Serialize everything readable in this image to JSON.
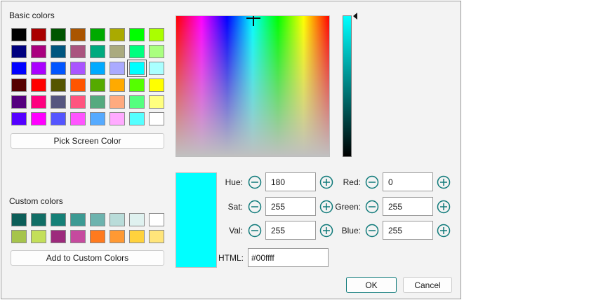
{
  "basic_colors": {
    "label": "Basic colors",
    "swatches": [
      "#000000",
      "#aa0000",
      "#005500",
      "#aa5500",
      "#00aa00",
      "#aaaa00",
      "#00ff00",
      "#aaff00",
      "#00007f",
      "#aa007f",
      "#00557f",
      "#aa557f",
      "#00aa7f",
      "#aaaa7f",
      "#00ff7f",
      "#aaff7f",
      "#0000ff",
      "#aa00ff",
      "#0055ff",
      "#aa55ff",
      "#00aaff",
      "#aaaaff",
      "#00ffff",
      "#aaffff",
      "#550000",
      "#ff0000",
      "#555500",
      "#ff5500",
      "#55aa00",
      "#ffaa00",
      "#55ff00",
      "#ffff00",
      "#55007f",
      "#ff007f",
      "#55557f",
      "#ff557f",
      "#55aa7f",
      "#ffaa7f",
      "#55ff7f",
      "#ffff7f",
      "#5500ff",
      "#ff00ff",
      "#5555ff",
      "#ff55ff",
      "#55aaff",
      "#ffaaff",
      "#55ffff",
      "#ffffff"
    ],
    "selected_index": 22
  },
  "pick_screen_color_label": "Pick Screen Color",
  "custom_colors": {
    "label": "Custom colors",
    "swatches": [
      "#0c5e59",
      "#116e66",
      "#158077",
      "#3c9a93",
      "#6db3ae",
      "#b9dcd9",
      "#dff1ef",
      "#ffffff",
      "#a6c44c",
      "#c3df59",
      "#9d2a7c",
      "#c64a9e",
      "#ff7a1e",
      "#ff9933",
      "#ffd23d",
      "#ffe57a"
    ]
  },
  "add_to_custom_label": "Add to Custom Colors",
  "current_color": "#00ffff",
  "hsv": {
    "hue_label": "Hue:",
    "hue": "180",
    "sat_label": "Sat:",
    "sat": "255",
    "val_label": "Val:",
    "val": "255"
  },
  "rgb": {
    "red_label": "Red:",
    "red": "0",
    "green_label": "Green:",
    "green": "255",
    "blue_label": "Blue:",
    "blue": "255"
  },
  "html_label": "HTML:",
  "html_value": "#00ffff",
  "ok_label": "OK",
  "cancel_label": "Cancel"
}
